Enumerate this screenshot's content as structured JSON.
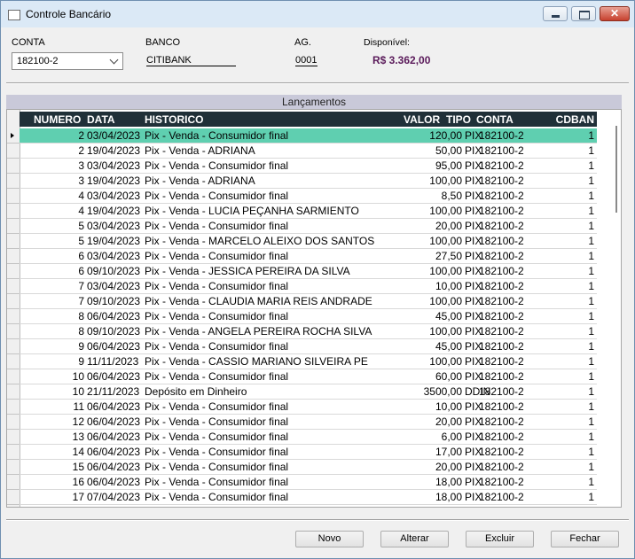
{
  "window": {
    "title": "Controle Bancário",
    "close_glyph": "✕"
  },
  "header": {
    "conta_label": "CONTA",
    "conta_value": "182100-2",
    "banco_label": "BANCO",
    "banco_value": "CITIBANK",
    "ag_label": "AG.",
    "ag_value": "0001",
    "disponivel_label": "Disponível:",
    "disponivel_value": "R$ 3.362,00"
  },
  "colors": {
    "selected_row": "#5fcfb0",
    "grid_header_bg": "#203038",
    "balance": "#5a1a5a"
  },
  "grid": {
    "section_title": "Lançamentos",
    "columns": [
      "NUMERO",
      "DATA",
      "HISTORICO",
      "VALOR",
      "TIPO",
      "CONTA",
      "CDBAN"
    ],
    "selected_index": 0,
    "rows": [
      {
        "numero": "2",
        "data": "03/04/2023",
        "historico": "Pix - Venda - Consumidor final",
        "valor": "120,00",
        "tipo": "PIX",
        "conta": "182100-2",
        "cdban": "1"
      },
      {
        "numero": "2",
        "data": "19/04/2023",
        "historico": "Pix - Venda - ADRIANA",
        "valor": "50,00",
        "tipo": "PIX",
        "conta": "182100-2",
        "cdban": "1"
      },
      {
        "numero": "3",
        "data": "03/04/2023",
        "historico": "Pix - Venda - Consumidor final",
        "valor": "95,00",
        "tipo": "PIX",
        "conta": "182100-2",
        "cdban": "1"
      },
      {
        "numero": "3",
        "data": "19/04/2023",
        "historico": "Pix - Venda - ADRIANA",
        "valor": "100,00",
        "tipo": "PIX",
        "conta": "182100-2",
        "cdban": "1"
      },
      {
        "numero": "4",
        "data": "03/04/2023",
        "historico": "Pix - Venda - Consumidor final",
        "valor": "8,50",
        "tipo": "PIX",
        "conta": "182100-2",
        "cdban": "1"
      },
      {
        "numero": "4",
        "data": "19/04/2023",
        "historico": "Pix - Venda - LUCIA PEÇANHA SARMIENTO",
        "valor": "100,00",
        "tipo": "PIX",
        "conta": "182100-2",
        "cdban": "1"
      },
      {
        "numero": "5",
        "data": "03/04/2023",
        "historico": "Pix - Venda - Consumidor final",
        "valor": "20,00",
        "tipo": "PIX",
        "conta": "182100-2",
        "cdban": "1"
      },
      {
        "numero": "5",
        "data": "19/04/2023",
        "historico": "Pix - Venda - MARCELO ALEIXO DOS SANTOS",
        "valor": "100,00",
        "tipo": "PIX",
        "conta": "182100-2",
        "cdban": "1"
      },
      {
        "numero": "6",
        "data": "03/04/2023",
        "historico": "Pix - Venda - Consumidor final",
        "valor": "27,50",
        "tipo": "PIX",
        "conta": "182100-2",
        "cdban": "1"
      },
      {
        "numero": "6",
        "data": "09/10/2023",
        "historico": "Pix - Venda - JESSICA PEREIRA DA SILVA",
        "valor": "100,00",
        "tipo": "PIX",
        "conta": "182100-2",
        "cdban": "1"
      },
      {
        "numero": "7",
        "data": "03/04/2023",
        "historico": "Pix - Venda - Consumidor final",
        "valor": "10,00",
        "tipo": "PIX",
        "conta": "182100-2",
        "cdban": "1"
      },
      {
        "numero": "7",
        "data": "09/10/2023",
        "historico": "Pix - Venda - CLAUDIA MARIA REIS ANDRADE",
        "valor": "100,00",
        "tipo": "PIX",
        "conta": "182100-2",
        "cdban": "1"
      },
      {
        "numero": "8",
        "data": "06/04/2023",
        "historico": "Pix - Venda - Consumidor final",
        "valor": "45,00",
        "tipo": "PIX",
        "conta": "182100-2",
        "cdban": "1"
      },
      {
        "numero": "8",
        "data": "09/10/2023",
        "historico": "Pix - Venda - ANGELA PEREIRA ROCHA SILVA",
        "valor": "100,00",
        "tipo": "PIX",
        "conta": "182100-2",
        "cdban": "1"
      },
      {
        "numero": "9",
        "data": "06/04/2023",
        "historico": "Pix - Venda - Consumidor final",
        "valor": "45,00",
        "tipo": "PIX",
        "conta": "182100-2",
        "cdban": "1"
      },
      {
        "numero": "9",
        "data": "11/11/2023",
        "historico": "Pix - Venda - CASSIO MARIANO SILVEIRA PE",
        "valor": "100,00",
        "tipo": "PIX",
        "conta": "182100-2",
        "cdban": "1"
      },
      {
        "numero": "10",
        "data": "06/04/2023",
        "historico": "Pix - Venda - Consumidor final",
        "valor": "60,00",
        "tipo": "PIX",
        "conta": "182100-2",
        "cdban": "1"
      },
      {
        "numero": "10",
        "data": "21/11/2023",
        "historico": "Depósito em Dinheiro",
        "valor": "3500,00",
        "tipo": "DDIN",
        "conta": "182100-2",
        "cdban": "1"
      },
      {
        "numero": "11",
        "data": "06/04/2023",
        "historico": "Pix - Venda - Consumidor final",
        "valor": "10,00",
        "tipo": "PIX",
        "conta": "182100-2",
        "cdban": "1"
      },
      {
        "numero": "12",
        "data": "06/04/2023",
        "historico": "Pix - Venda - Consumidor final",
        "valor": "20,00",
        "tipo": "PIX",
        "conta": "182100-2",
        "cdban": "1"
      },
      {
        "numero": "13",
        "data": "06/04/2023",
        "historico": "Pix - Venda - Consumidor final",
        "valor": "6,00",
        "tipo": "PIX",
        "conta": "182100-2",
        "cdban": "1"
      },
      {
        "numero": "14",
        "data": "06/04/2023",
        "historico": "Pix - Venda - Consumidor final",
        "valor": "17,00",
        "tipo": "PIX",
        "conta": "182100-2",
        "cdban": "1"
      },
      {
        "numero": "15",
        "data": "06/04/2023",
        "historico": "Pix - Venda - Consumidor final",
        "valor": "20,00",
        "tipo": "PIX",
        "conta": "182100-2",
        "cdban": "1"
      },
      {
        "numero": "16",
        "data": "06/04/2023",
        "historico": "Pix - Venda - Consumidor final",
        "valor": "18,00",
        "tipo": "PIX",
        "conta": "182100-2",
        "cdban": "1"
      },
      {
        "numero": "17",
        "data": "07/04/2023",
        "historico": "Pix - Venda - Consumidor final",
        "valor": "18,00",
        "tipo": "PIX",
        "conta": "182100-2",
        "cdban": "1"
      }
    ]
  },
  "buttons": {
    "novo": "Novo",
    "alterar": "Alterar",
    "excluir": "Excluir",
    "fechar": "Fechar"
  }
}
